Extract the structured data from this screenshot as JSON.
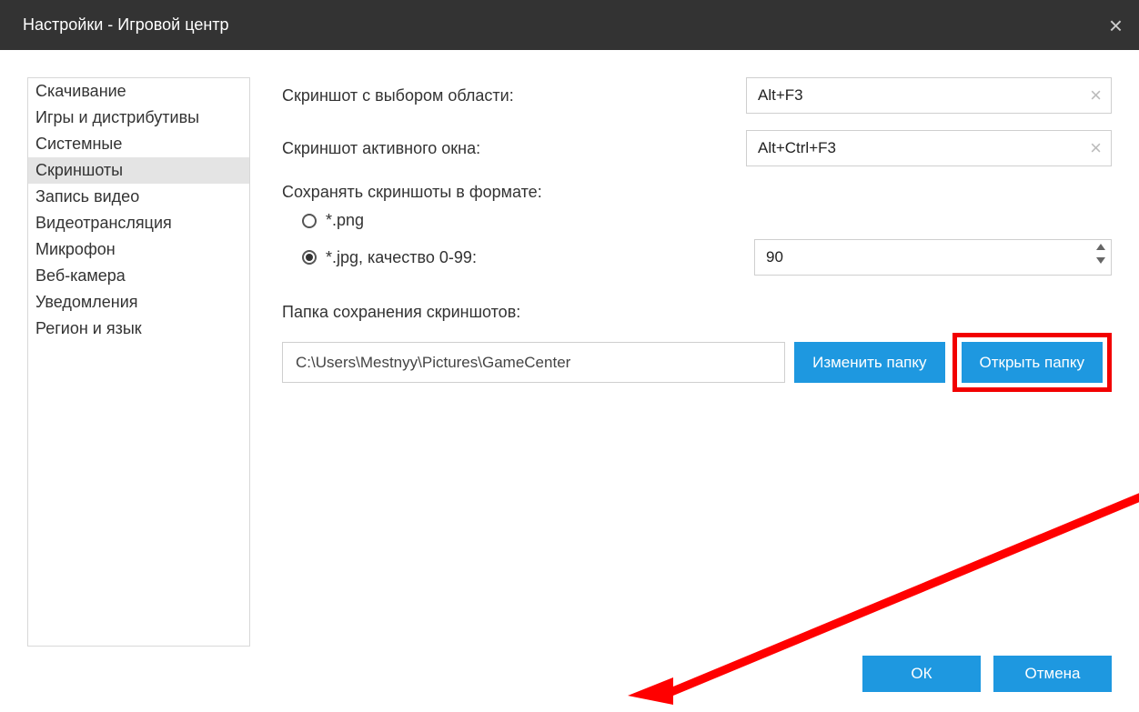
{
  "titlebar": {
    "title": "Настройки - Игровой центр"
  },
  "sidebar": {
    "items": [
      {
        "label": "Скачивание"
      },
      {
        "label": "Игры и дистрибутивы"
      },
      {
        "label": "Системные"
      },
      {
        "label": "Скриншоты"
      },
      {
        "label": "Запись видео"
      },
      {
        "label": "Видеотрансляция"
      },
      {
        "label": "Микрофон"
      },
      {
        "label": "Веб-камера"
      },
      {
        "label": "Уведомления"
      },
      {
        "label": "Регион и язык"
      }
    ],
    "selected_index": 3
  },
  "main": {
    "hotkey_area": {
      "label": "Скриншот с выбором области:",
      "value": "Alt+F3"
    },
    "hotkey_window": {
      "label": "Скриншот активного окна:",
      "value": "Alt+Ctrl+F3"
    },
    "format_label": "Сохранять скриншоты в формате:",
    "format_png": "*.png",
    "format_jpg": "*.jpg, качество 0-99:",
    "quality": "90",
    "folder_label": "Папка сохранения скриншотов:",
    "folder_path": "C:\\Users\\Mestnyy\\Pictures\\GameCenter",
    "btn_change": "Изменить папку",
    "btn_open": "Открыть папку"
  },
  "footer": {
    "ok": "ОК",
    "cancel": "Отмена"
  }
}
